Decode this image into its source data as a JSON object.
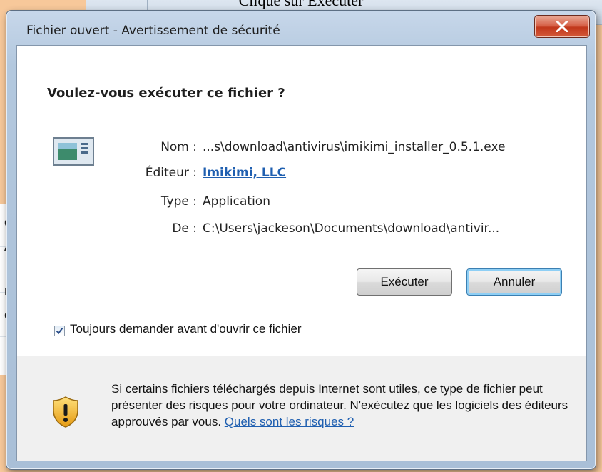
{
  "caption": "Clique sur Exécuter",
  "background": {
    "side_chars": [
      "o",
      "A",
      "n",
      "ca"
    ]
  },
  "dialog": {
    "title": "Fichier ouvert - Avertissement de sécurité",
    "heading": "Voulez-vous exécuter ce fichier ?",
    "fields": {
      "name_label": "Nom :",
      "name_value": "...s\\download\\antivirus\\imikimi_installer_0.5.1.exe",
      "publisher_label": "Éditeur :",
      "publisher_value": "Imikimi, LLC",
      "type_label": "Type :",
      "type_value": "Application",
      "from_label": "De :",
      "from_value": "C:\\Users\\jackeson\\Documents\\download\\antivir..."
    },
    "buttons": {
      "run": "Exécuter",
      "cancel": "Annuler"
    },
    "checkbox": {
      "label": "Toujours demander avant d'ouvrir ce fichier",
      "checked": true
    },
    "warning": {
      "text": "Si certains fichiers téléchargés depuis Internet sont utiles, ce type de fichier peut présenter des risques pour votre ordinateur. N'exécutez que les logiciels des éditeurs approuvés par vous.",
      "link": "Quels sont les risques ?"
    },
    "icons": {
      "close": "close-icon",
      "file": "application-file-icon",
      "shield": "warning-shield-icon",
      "check": "checkmark-icon"
    }
  }
}
